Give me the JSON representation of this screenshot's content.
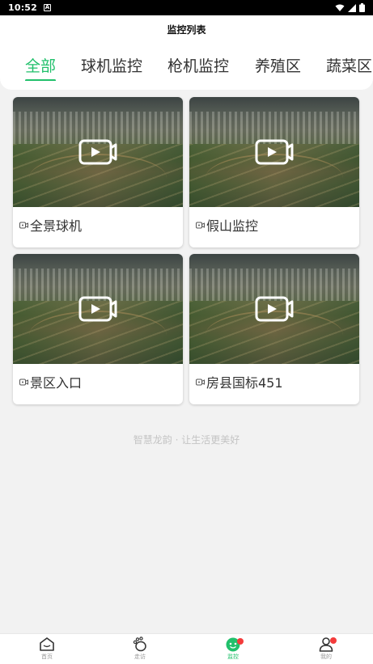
{
  "status_bar": {
    "time": "10:52",
    "app_icon": "A"
  },
  "header": {
    "title": "监控列表"
  },
  "tabs": [
    {
      "label": "全部",
      "active": true
    },
    {
      "label": "球机监控",
      "active": false
    },
    {
      "label": "枪机监控",
      "active": false
    },
    {
      "label": "养殖区",
      "active": false
    },
    {
      "label": "蔬菜区",
      "active": false
    }
  ],
  "cameras": [
    {
      "name": "全景球机",
      "icon": "video-camera-icon"
    },
    {
      "name": "假山监控",
      "icon": "video-camera-icon"
    },
    {
      "name": "景区入口",
      "icon": "video-camera-icon"
    },
    {
      "name": "房县国标451",
      "icon": "video-camera-icon"
    }
  ],
  "footer": {
    "slogan": "智慧龙韵 · 让生活更美好"
  },
  "bottom_nav": [
    {
      "label": "首页",
      "icon": "home-icon",
      "active": false,
      "badge": false
    },
    {
      "label": "走访",
      "icon": "footprint-icon",
      "active": false,
      "badge": false
    },
    {
      "label": "监控",
      "icon": "monitor-icon",
      "active": true,
      "badge": true
    },
    {
      "label": "我的",
      "icon": "user-icon",
      "active": false,
      "badge": true
    }
  ],
  "colors": {
    "accent": "#21c06b",
    "badge": "#f33b3b",
    "background": "#f2f2f2"
  }
}
